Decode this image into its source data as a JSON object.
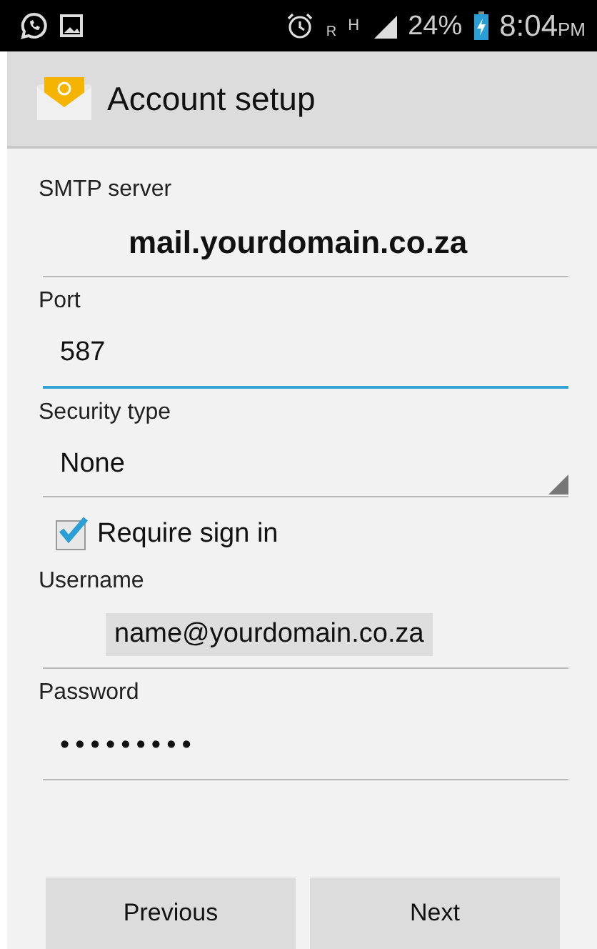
{
  "status_bar": {
    "battery": "24%",
    "time": "8:04",
    "meridiem": "PM",
    "roaming": "R",
    "network": "H"
  },
  "action_bar": {
    "title": "Account setup"
  },
  "fields": [
    {
      "kind": "text",
      "label": "SMTP server",
      "value": "mail.yourdomain.co.za",
      "emphasized": true,
      "focused": false
    },
    {
      "kind": "text",
      "label": "Port",
      "value": "587",
      "emphasized": false,
      "focused": true
    },
    {
      "kind": "select",
      "label": "Security type",
      "value": "None",
      "emphasized": false,
      "focused": false
    },
    {
      "kind": "checkbox",
      "label": "Require sign in",
      "checked": true
    },
    {
      "kind": "text",
      "label": "Username",
      "value": "name@yourdomain.co.za",
      "emphasized": false,
      "focused": false,
      "highlighted": true
    },
    {
      "kind": "password",
      "label": "Password",
      "value": "•••••••••",
      "emphasized": false,
      "focused": false
    }
  ],
  "buttons": [
    "Previous",
    "Next"
  ]
}
